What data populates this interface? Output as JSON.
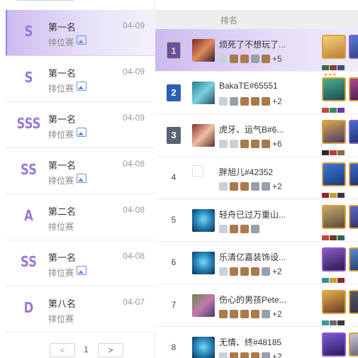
{
  "matches": [
    {
      "grade": "S",
      "place": "第一名",
      "mode": "排位赛",
      "date": "04-09",
      "has_image": true,
      "active": true
    },
    {
      "grade": "S",
      "place": "第一名",
      "mode": "排位赛",
      "date": "04-09",
      "has_image": true,
      "active": false
    },
    {
      "grade": "SSS",
      "place": "第一名",
      "mode": "排位赛",
      "date": "04-09",
      "has_image": true,
      "active": false
    },
    {
      "grade": "SS",
      "place": "第一名",
      "mode": "排位赛",
      "date": "04-08",
      "has_image": true,
      "active": false
    },
    {
      "grade": "A",
      "place": "第二名",
      "mode": "排位赛",
      "date": "04-08",
      "has_image": false,
      "active": false
    },
    {
      "grade": "SS",
      "place": "第一名",
      "mode": "排位赛",
      "date": "04-08",
      "has_image": true,
      "active": false
    },
    {
      "grade": "D",
      "place": "第八名",
      "mode": "排位赛",
      "date": "04-07",
      "has_image": false,
      "active": false
    }
  ],
  "pagination": {
    "prev": "<",
    "page": "1",
    "next": ">"
  },
  "table": {
    "header": "排名",
    "rows": [
      {
        "rank": "1",
        "name": "烦死了不想玩了...",
        "more": "+5",
        "active": true
      },
      {
        "rank": "2",
        "name": "BakaTE#65551",
        "more": "+2",
        "active": false
      },
      {
        "rank": "3",
        "name": "虎牙、运气B#6...",
        "more": "+6",
        "active": false
      },
      {
        "rank": "4",
        "name": "胖旭儿#42352",
        "more": "+2",
        "active": false
      },
      {
        "rank": "5",
        "name": "轻舟已过万重山...",
        "more": "",
        "active": false
      },
      {
        "rank": "6",
        "name": "乐清亿嘉装饰设...",
        "more": "+2",
        "active": false
      },
      {
        "rank": "7",
        "name": "伤心的男孩Pete...",
        "more": "+2",
        "active": false
      },
      {
        "rank": "8",
        "name": "无情、终#48185",
        "more": "+2",
        "active": false
      }
    ]
  },
  "colors": {
    "accent": "#9a78d6",
    "active_bg": "#cbbbf0",
    "header_bg": "#eeeeef"
  }
}
